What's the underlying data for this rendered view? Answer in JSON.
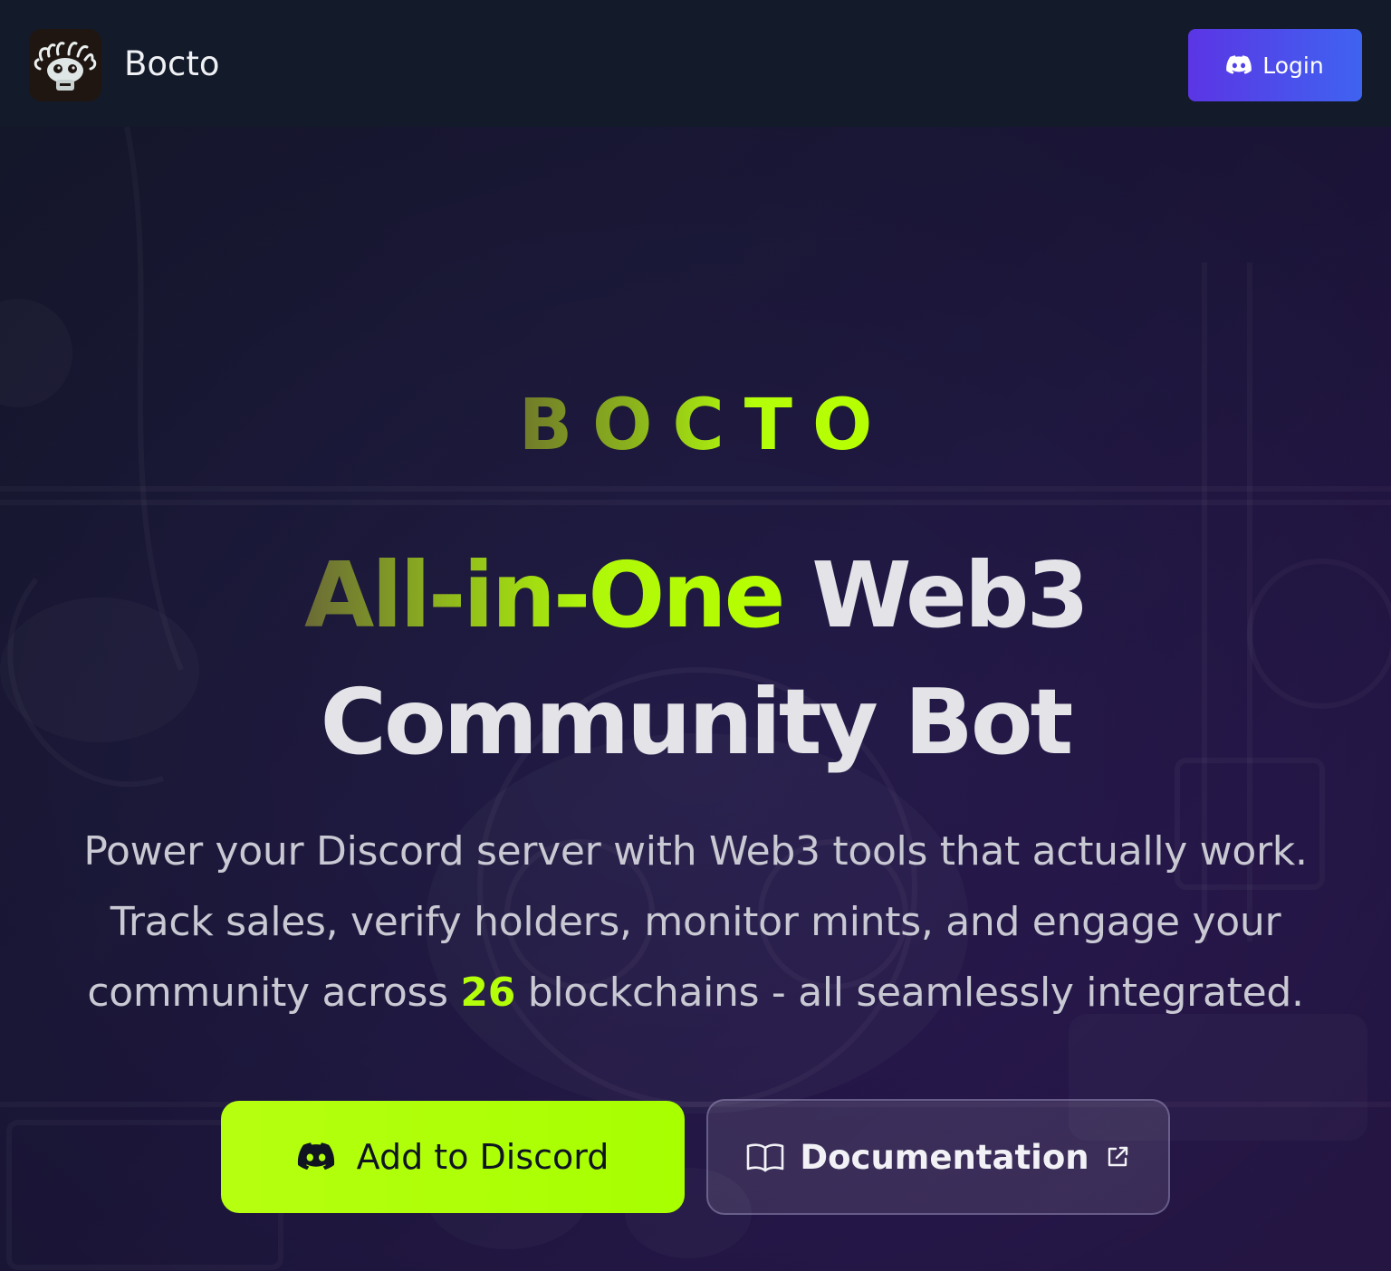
{
  "header": {
    "logo_icon": "bocto-mascot-logo",
    "brand_name": "Bocto",
    "login_label": "Login",
    "login_icon": "discord-icon"
  },
  "hero": {
    "kicker": "BOCTO",
    "headline_accent": "All-in-One",
    "headline_rest_line1": "Web3",
    "headline_line2": "Community Bot",
    "subtitle_before": "Power your Discord server with Web3 tools that actually work. Track sales, verify holders, monitor mints, and engage your community across ",
    "subtitle_number": "26",
    "subtitle_after": " blockchains - all seamlessly integrated.",
    "primary_cta_label": "Add to Discord",
    "primary_cta_icon": "discord-icon",
    "secondary_cta_label": "Documentation",
    "secondary_cta_icon": "book-open-icon",
    "secondary_cta_trailing_icon": "external-link-icon"
  },
  "colors": {
    "header_bg": "#131a29",
    "login_gradient_start": "#5b35e4",
    "login_gradient_end": "#3f63f1",
    "accent_lime": "#b4fe0a",
    "headline_text": "#e3e3e8",
    "subtitle_text": "#c9c9d3"
  }
}
